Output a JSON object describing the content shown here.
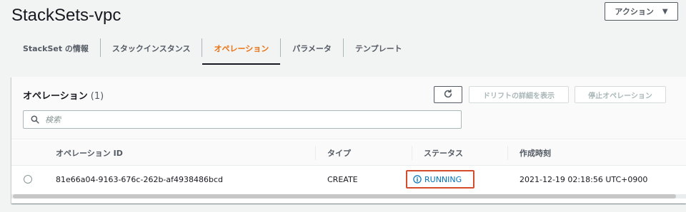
{
  "page": {
    "title": "StackSets-vpc",
    "actions_label": "アクション"
  },
  "tabs": [
    {
      "label": "StackSet の情報",
      "active": false
    },
    {
      "label": "スタックインスタンス",
      "active": false
    },
    {
      "label": "オペレーション",
      "active": true
    },
    {
      "label": "パラメータ",
      "active": false
    },
    {
      "label": "テンプレート",
      "active": false
    }
  ],
  "panel": {
    "title": "オペレーション",
    "count": "(1)",
    "drift_button": "ドリフトの詳細を表示",
    "stop_button": "停止オペレーション",
    "search_placeholder": "検索"
  },
  "table": {
    "columns": [
      "オペレーション ID",
      "タイプ",
      "ステータス",
      "作成時刻"
    ],
    "rows": [
      {
        "id": "81e66a04-9163-676c-262b-af4938486bcd",
        "type": "CREATE",
        "status": "RUNNING",
        "created": "2021-12-19 02:18:56 UTC+0900"
      }
    ]
  },
  "colors": {
    "accent": "#ec7211",
    "status_info": "#0073bb",
    "highlight_border": "#d44c2c"
  },
  "icons": {
    "actions_caret": "caret-down-icon",
    "refresh": "refresh-icon",
    "search": "search-icon",
    "status": "info-circle-icon"
  }
}
